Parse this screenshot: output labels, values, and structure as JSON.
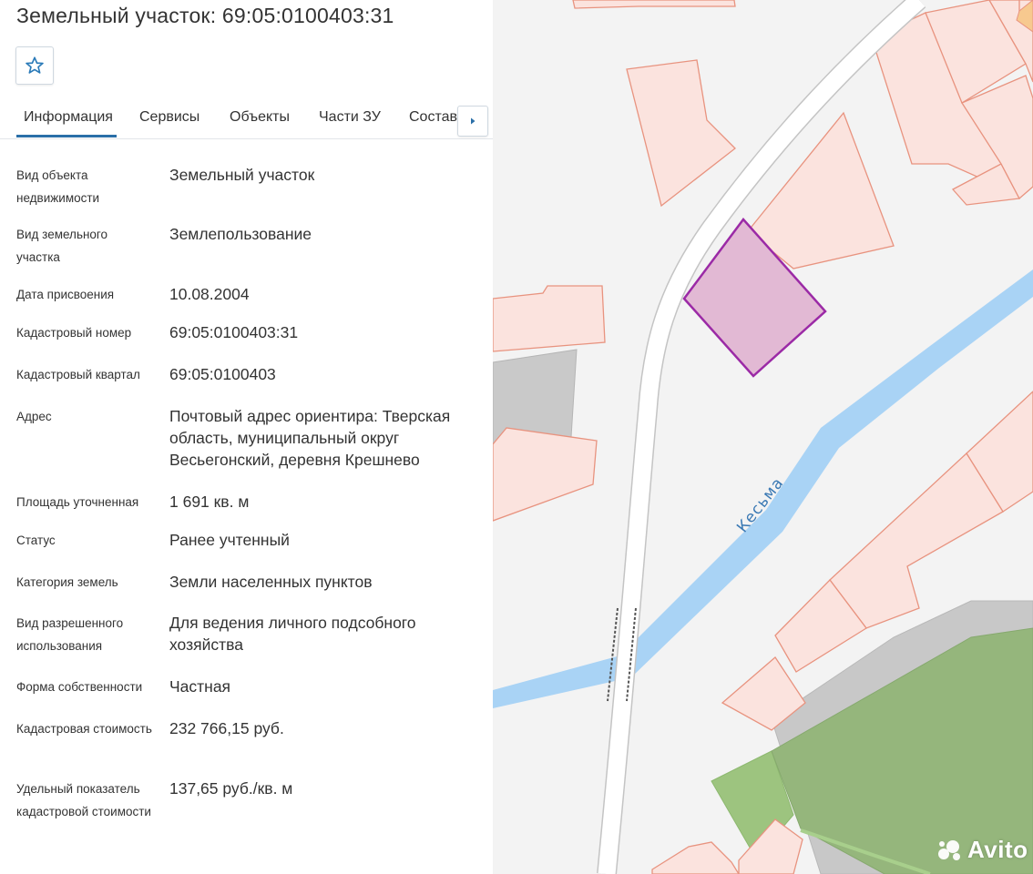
{
  "header": {
    "title": "Земельный участок: 69:05:0100403:31"
  },
  "favorite": {
    "icon": "star-icon"
  },
  "tabs": [
    {
      "label": "Информация",
      "active": true
    },
    {
      "label": "Сервисы",
      "active": false
    },
    {
      "label": "Объекты",
      "active": false
    },
    {
      "label": "Части ЗУ",
      "active": false
    },
    {
      "label": "Состав",
      "active": false
    }
  ],
  "tab_next_icon": "caret-right-icon",
  "info": [
    {
      "label": "Вид объекта недвижимости",
      "value": "Земельный участок"
    },
    {
      "label": "Вид земельного участка",
      "value": "Землепользование"
    },
    {
      "label": "Дата присвоения",
      "value": "10.08.2004"
    },
    {
      "label": "Кадастровый номер",
      "value": "69:05:0100403:31"
    },
    {
      "label": "Кадастровый квартал",
      "value": "69:05:0100403"
    },
    {
      "label": "Адрес",
      "value": "Почтовый адрес ориентира: Тверская область, муниципальный округ Весьегонский, деревня Крешнево"
    },
    {
      "label": "Площадь уточненная",
      "value": "1 691 кв. м"
    },
    {
      "label": "Статус",
      "value": "Ранее учтенный"
    },
    {
      "label": "Категория земель",
      "value": "Земли населенных пунктов"
    },
    {
      "label": "Вид разрешенного использования",
      "value": "Для ведения личного подсобного хозяйства"
    },
    {
      "label": "Форма собственности",
      "value": "Частная"
    },
    {
      "label": "Кадастровая стоимость",
      "value": "232 766,15 руб."
    },
    {
      "label": "Удельный показатель кадастровой стоимости",
      "value": "137,65 руб./кв. м"
    }
  ],
  "map": {
    "river_label": "Кесьма",
    "colors": {
      "parcel_fill": "#fbe3de",
      "parcel_stroke": "#e8937f",
      "selected_fill": "#e2b9d4",
      "selected_stroke": "#9b2aa6",
      "river": "#a9d3f5",
      "road": "#ffffff",
      "green": "#9cc07f",
      "gray": "#c9c9c9"
    }
  },
  "watermark": "Avito"
}
